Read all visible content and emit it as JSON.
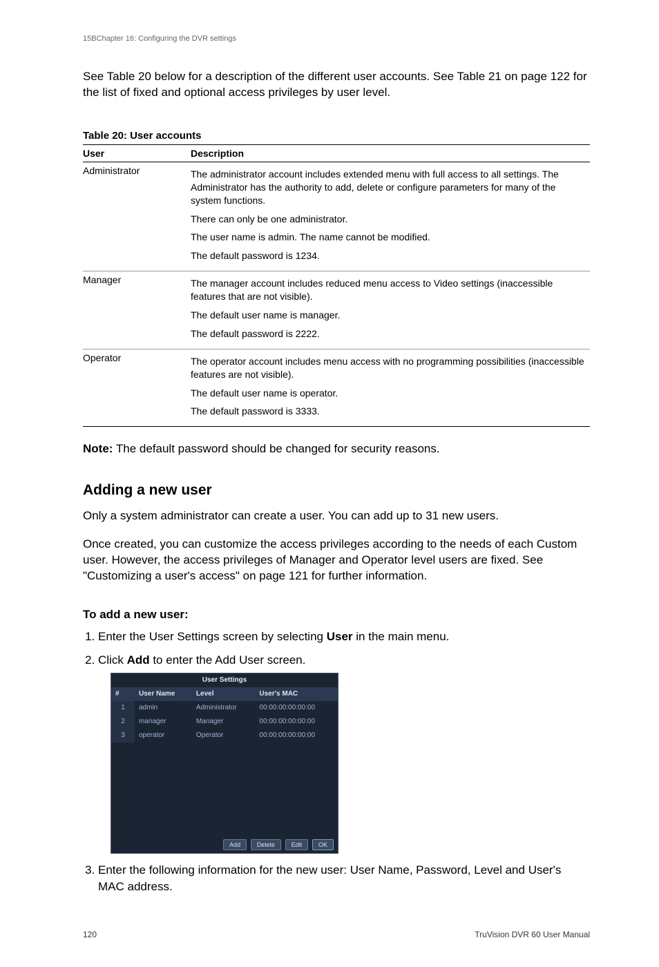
{
  "header_caption": "15BChapter 16: Configuring the DVR settings",
  "intro_paragraph": "See Table 20 below for a description of the different user accounts. See Table 21 on page 122 for the list of fixed and optional access privileges by user level.",
  "table_title": "Table 20: User accounts",
  "table_headers": {
    "col1": "User",
    "col2": "Description"
  },
  "table": {
    "admin": {
      "name": "Administrator",
      "p1": "The administrator account includes extended menu with full access to all settings. The Administrator has the authority to add, delete or configure parameters for many of the system functions.",
      "p2": "There can only be one administrator.",
      "p3": "The user name is admin. The name cannot be modified.",
      "p4": "The default password is 1234."
    },
    "manager": {
      "name": "Manager",
      "p1": "The manager account includes reduced menu access to Video settings (inaccessible features that are not visible).",
      "p2": "The default user name is manager.",
      "p3": "The default password is 2222."
    },
    "operator": {
      "name": "Operator",
      "p1": "The operator account includes menu access with no programming possibilities (inaccessible features are not visible).",
      "p2": "The default user name is operator.",
      "p3": "The default password is 3333."
    }
  },
  "note_label": "Note:",
  "note_text": " The default password should be changed for security reasons.",
  "section_heading": "Adding a new user",
  "para_add1": "Only a system administrator can create a user. You can add up to 31 new users.",
  "para_add2": "Once created, you can customize the access privileges according to the needs of each Custom user. However, the access privileges of Manager and Operator level users are fixed. See \"Customizing a user's access\" on page 121 for further information.",
  "subheading": "To add a new user:",
  "steps": {
    "s1a": "Enter the User Settings screen by selecting ",
    "s1b": "User",
    "s1c": " in the main menu.",
    "s2a": "Click ",
    "s2b": "Add",
    "s2c": " to enter the Add User screen.",
    "s3": "Enter the following information for the new user: User Name, Password, Level and User's MAC address."
  },
  "screenshot": {
    "title": "User Settings",
    "headers": {
      "num": "#",
      "name": "User Name",
      "level": "Level",
      "mac": "User's MAC"
    },
    "rows": [
      {
        "num": "1",
        "name": "admin",
        "level": "Administrator",
        "mac": "00:00:00:00:00:00"
      },
      {
        "num": "2",
        "name": "manager",
        "level": "Manager",
        "mac": "00:00:00:00:00:00"
      },
      {
        "num": "3",
        "name": "operator",
        "level": "Operator",
        "mac": "00:00:00:00:00:00"
      }
    ],
    "buttons": {
      "add": "Add",
      "delete": "Delete",
      "edit": "Edit",
      "ok": "OK"
    }
  },
  "footer": {
    "page": "120",
    "doc": "TruVision DVR 60 User Manual"
  }
}
